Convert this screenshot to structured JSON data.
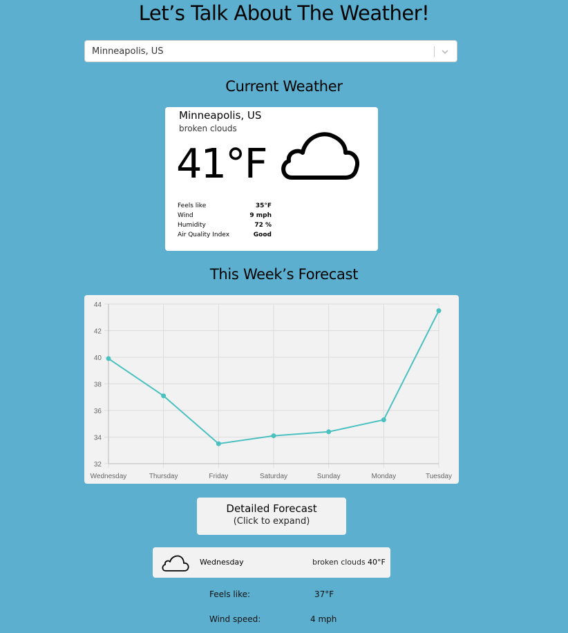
{
  "page": {
    "title": "Let’s Talk About The Weather!"
  },
  "city_select": {
    "value": "Minneapolis, US"
  },
  "current": {
    "heading": "Current Weather",
    "city": "Minneapolis, US",
    "description": "broken clouds",
    "temperature": "41°F",
    "icon": "cloud-icon",
    "details": [
      {
        "label": "Feels like",
        "value": "35°F"
      },
      {
        "label": "Wind",
        "value": "9 mph"
      },
      {
        "label": "Humidity",
        "value": "72 %"
      },
      {
        "label": "Air Quality Index",
        "value": "Good"
      }
    ]
  },
  "forecast": {
    "heading": "This Week’s Forecast"
  },
  "chart_data": {
    "type": "line",
    "categories": [
      "Wednesday",
      "Thursday",
      "Friday",
      "Saturday",
      "Sunday",
      "Monday",
      "Tuesday"
    ],
    "values": [
      39.9,
      37.1,
      33.5,
      34.1,
      34.4,
      35.3,
      43.5
    ],
    "ylim": [
      32,
      44
    ],
    "yticks": [
      "32",
      "34",
      "36",
      "38",
      "40",
      "42",
      "44"
    ],
    "grid": true,
    "line_color": "#4bc0c0"
  },
  "detailed": {
    "button_title": "Detailed Forecast",
    "button_subtitle": "(Click to expand)",
    "first_day": {
      "day": "Wednesday",
      "description": "broken clouds",
      "temperature": "40°F",
      "icon": "cloud-icon"
    },
    "feels_like_label": "Feels like:",
    "feels_like_value": "37°F",
    "wind_label": "Wind speed:",
    "wind_value": "4 mph"
  }
}
